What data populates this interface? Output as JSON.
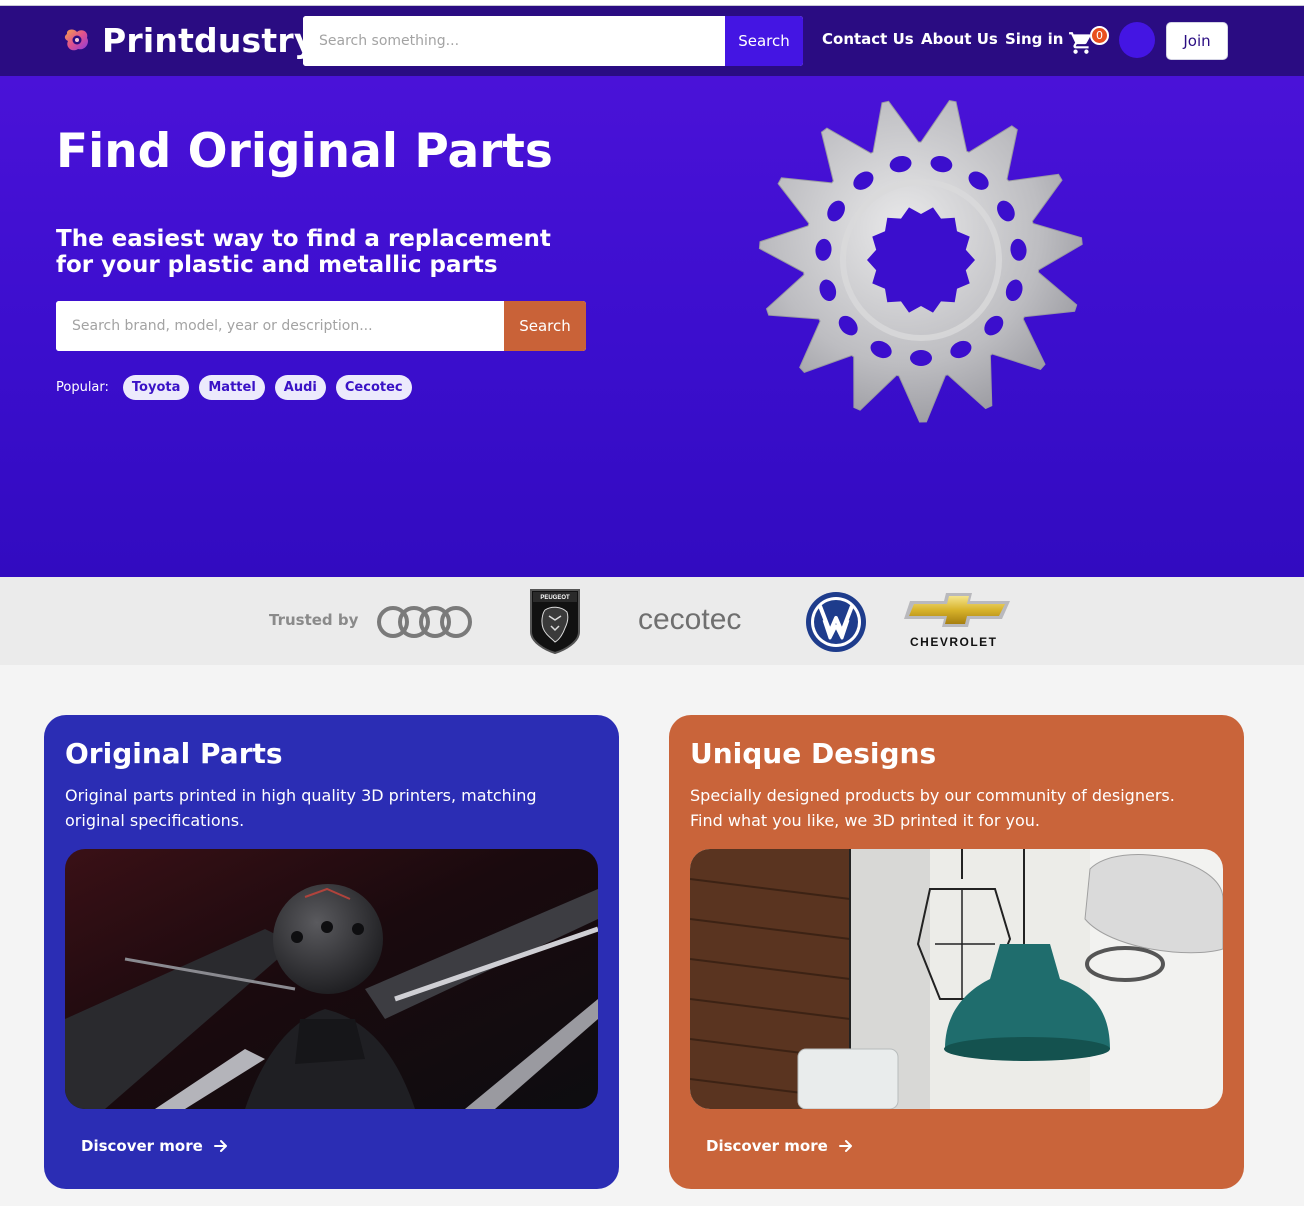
{
  "brand": {
    "name": "Printdustry"
  },
  "nav": {
    "search_placeholder": "Search something...",
    "search_button": "Search",
    "links": [
      "Contact Us",
      "About Us",
      "Sing in"
    ],
    "cart_count": "0",
    "join_label": "Join"
  },
  "hero": {
    "title": "Find Original Parts",
    "subtitle": "The easiest way to find a replacement for your plastic and metallic parts",
    "search_placeholder": "Search brand, model, year or description...",
    "search_button": "Search",
    "popular_label": "Popular:",
    "popular_tags": [
      "Toyota",
      "Mattel",
      "Audi",
      "Cecotec"
    ],
    "image": "metal-sprocket-gear"
  },
  "trusted": {
    "label": "Trusted by",
    "brands": [
      "Audi",
      "Peugeot",
      "cecotec",
      "Volkswagen",
      "CHEVROLET"
    ],
    "cecotec_text": "cecotec",
    "peugeot_text": "PEUGEOT",
    "chevrolet_text": "CHEVROLET"
  },
  "cards": [
    {
      "title": "Original Parts",
      "text": "Original parts printed in high quality 3D printers, matching original specifications.",
      "link": "Discover more",
      "image": "car-gear-shift-knob",
      "color": "#2b2db4"
    },
    {
      "title": "Unique Designs",
      "text": "Specially designed products by our community of designers. Find what you like, we 3D printed it for you.",
      "link": "Discover more",
      "image": "pendant-lamps",
      "color": "#c9643a"
    }
  ],
  "colors": {
    "navbar": "#2a0c82",
    "accent": "#4415e3",
    "hero": "#3b0ecd",
    "cta_orange": "#c96238"
  }
}
